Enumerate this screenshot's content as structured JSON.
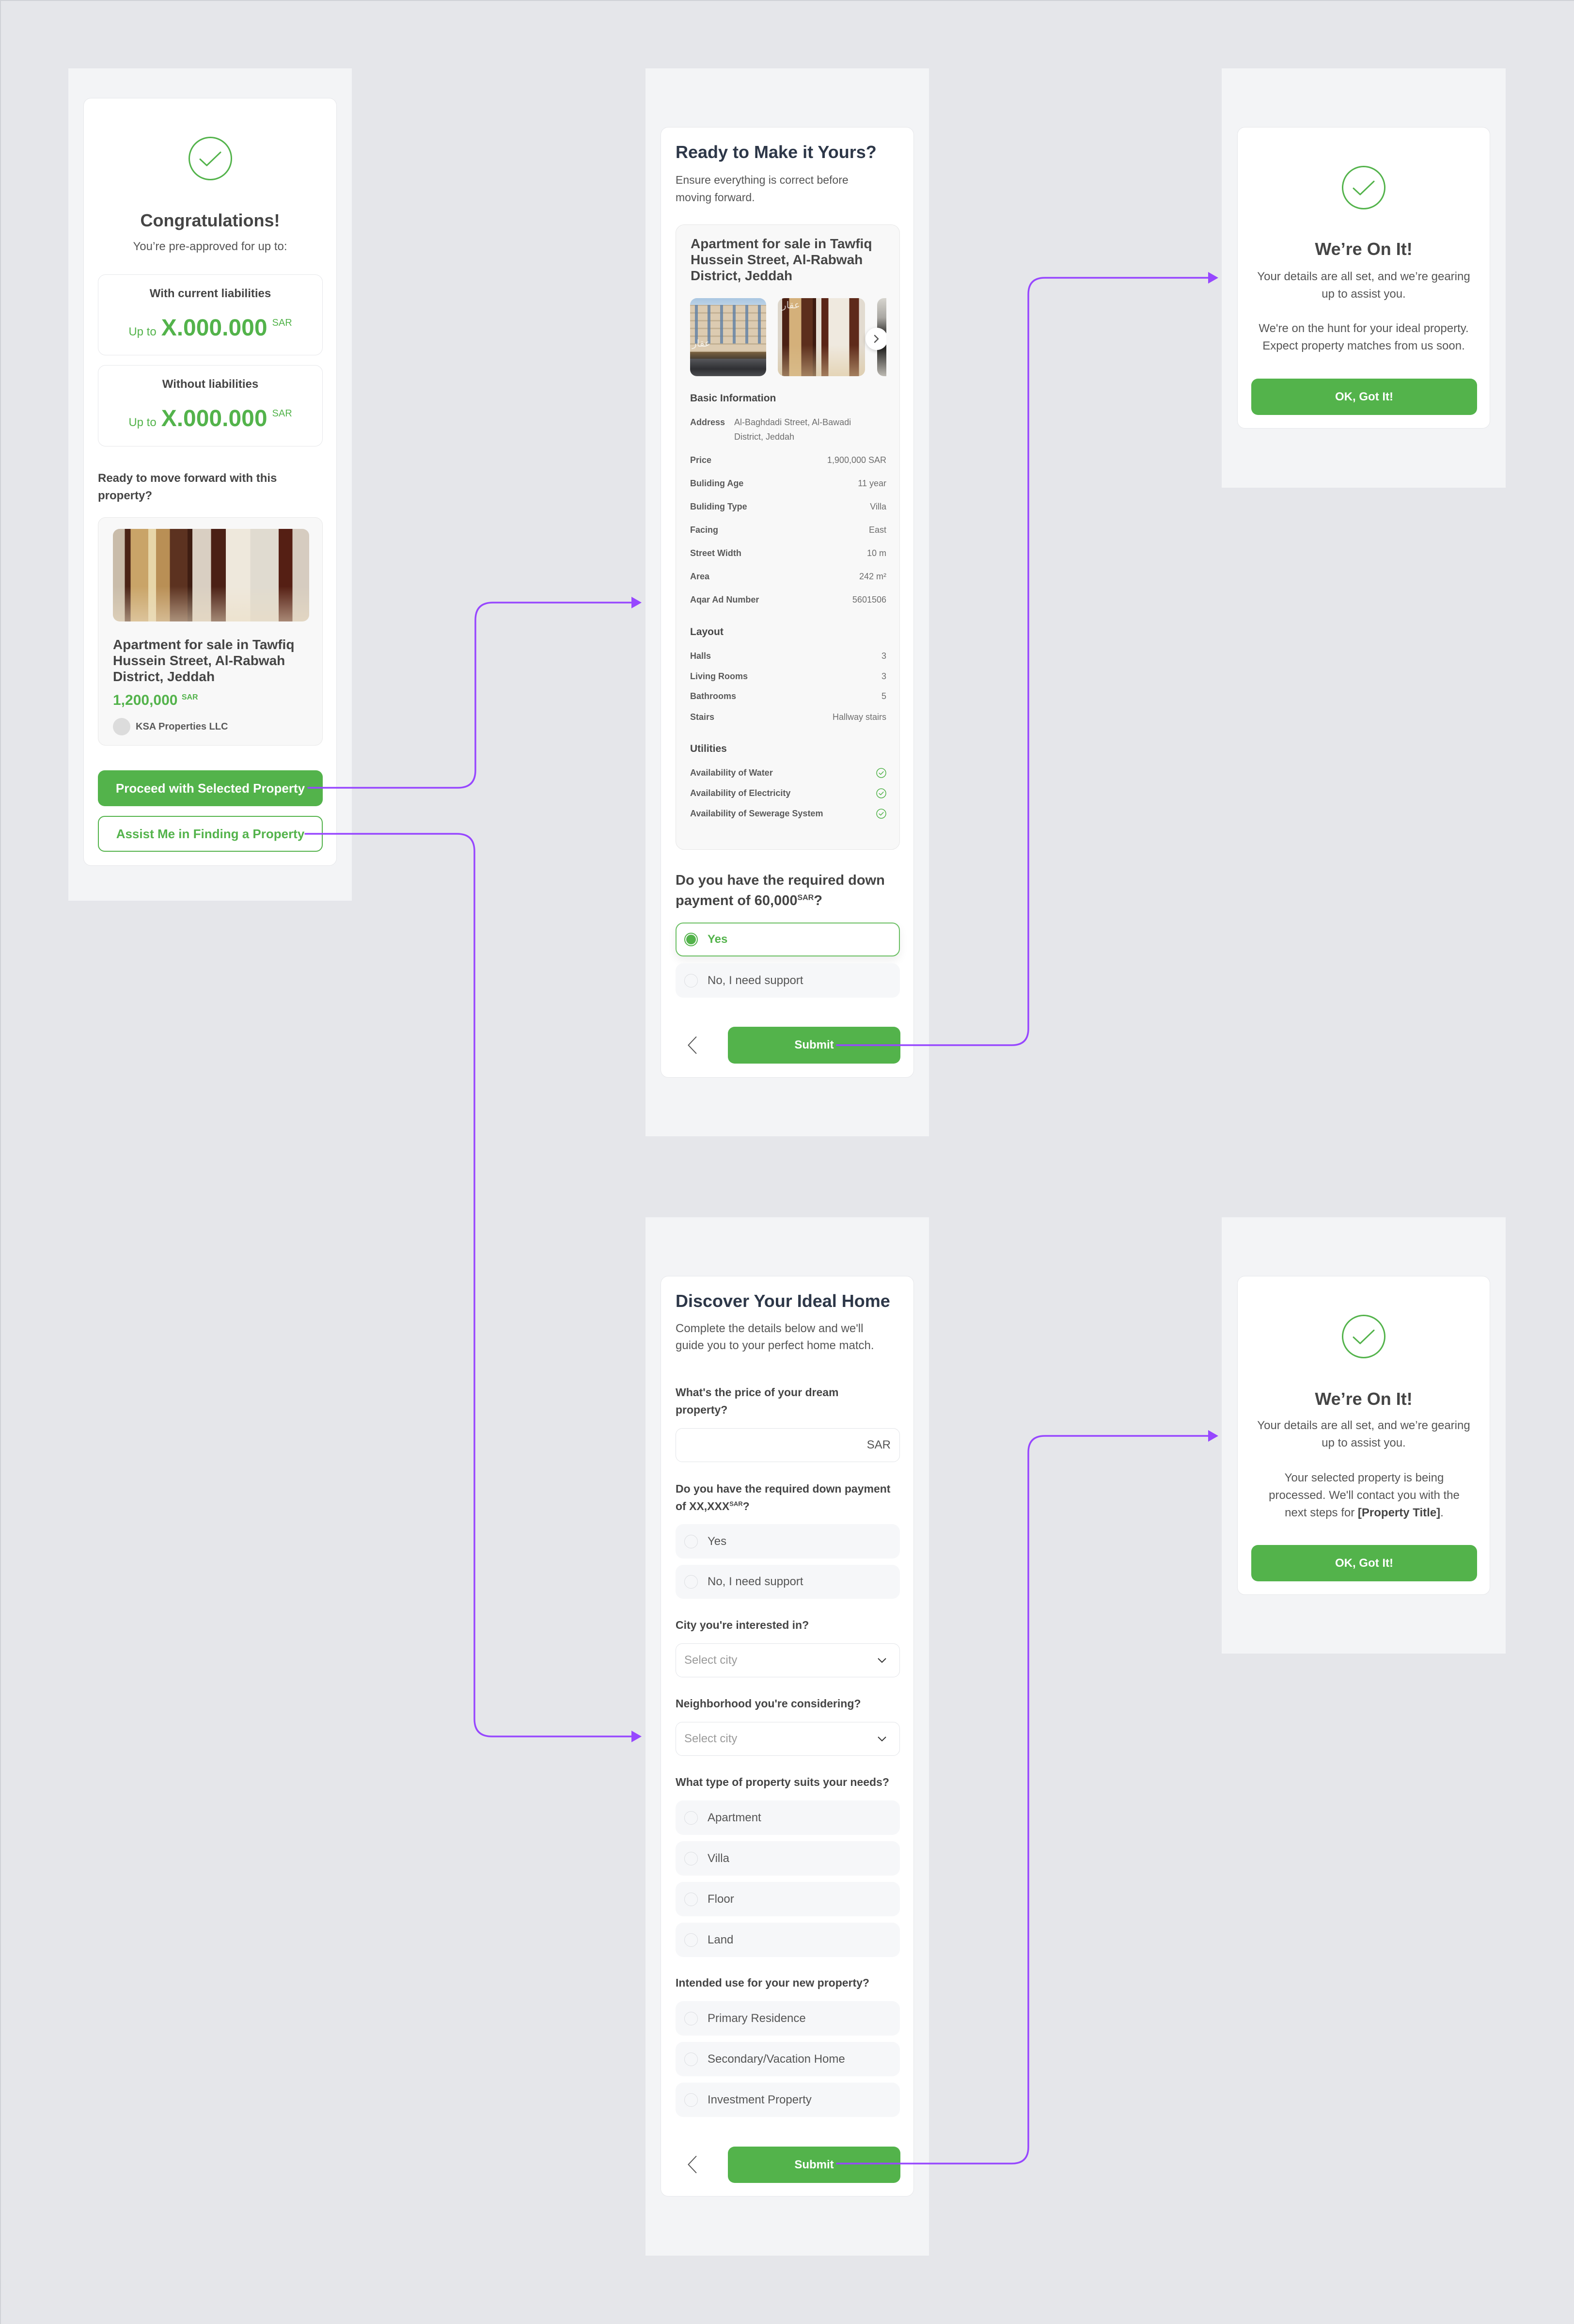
{
  "theme": {
    "accent": "#53b34b",
    "title_navy": "#2d3748",
    "flow_arrow": "#9747ff",
    "canvas": "#e5e6ea"
  },
  "pre_approval": {
    "status_icon": "check-circle-icon",
    "title": "Congratulations!",
    "subtitle": "You’re pre-approved for up to:",
    "offers": [
      {
        "label": "With current liabilities",
        "prefix": "Up to",
        "amount": "X.000.000",
        "currency": "SAR"
      },
      {
        "label": "Without liabilities",
        "prefix": "Up to",
        "amount": "X.000.000",
        "currency": "SAR"
      }
    ],
    "prompt": "Ready to move forward with this property?",
    "property": {
      "photo": "apartment-interior-photo",
      "title": "Apartment for sale in Tawfiq Hussein Street, Al-Rabwah District, Jeddah",
      "price": "1,200,000",
      "currency": "SAR",
      "agent": "KSA Properties LLC",
      "agent_avatar": "avatar-placeholder"
    },
    "primary_button": "Proceed with Selected Property",
    "secondary_button": "Assist Me in Finding a Property"
  },
  "confirm_property": {
    "title": "Ready to Make it Yours?",
    "subtitle": "Ensure everything is correct before moving forward.",
    "property_title": "Apartment for sale in Tawfiq Hussein Street, Al-Rabwah District, Jeddah",
    "gallery": {
      "photos": [
        "building-exterior-photo",
        "apartment-hallway-photo",
        "apartment-room-photo"
      ],
      "watermark": "عقار",
      "next_icon": "chevron-right-icon"
    },
    "basic_info": {
      "heading": "Basic Information",
      "rows": [
        {
          "label": "Address",
          "value": "Al-Baghdadi Street, Al-Bawadi District, Jeddah"
        },
        {
          "label": "Price",
          "value": "1,900,000 SAR"
        },
        {
          "label": "Buliding Age",
          "value": "11 year"
        },
        {
          "label": "Buliding Type",
          "value": "Villa"
        },
        {
          "label": "Facing",
          "value": "East"
        },
        {
          "label": "Street Width",
          "value": "10 m"
        },
        {
          "label": "Area",
          "value": "242 m²"
        },
        {
          "label": "Aqar Ad Number",
          "value": "5601506"
        }
      ]
    },
    "layout": {
      "heading": "Layout",
      "rows": [
        {
          "label": "Halls",
          "value": "3"
        },
        {
          "label": "Living Rooms",
          "value": "3"
        },
        {
          "label": "Bathrooms",
          "value": "5"
        },
        {
          "label": "Stairs",
          "value": "Hallway stairs"
        }
      ]
    },
    "utilities": {
      "heading": "Utilities",
      "icon": "check-circle-icon",
      "rows": [
        {
          "label": "Availability of Water",
          "available": true
        },
        {
          "label": "Availability of Electricity",
          "available": true
        },
        {
          "label": "Availability of Sewerage System",
          "available": true
        }
      ]
    },
    "question": {
      "prefix": "Do you have the required down payment of ",
      "amount": "60,000",
      "currency": "SAR",
      "suffix": "?"
    },
    "options": [
      {
        "label": "Yes",
        "selected": true
      },
      {
        "label": "No, I need support",
        "selected": false
      }
    ],
    "back_icon": "chevron-left-icon",
    "submit": "Submit"
  },
  "search_confirmation": {
    "status_icon": "check-circle-icon",
    "title": "We’re On It!",
    "paragraphs": [
      "Your details are all set, and we’re gearing up to assist you.",
      "We're on the hunt for your ideal property. Expect property matches from us soon."
    ],
    "button": "OK, Got It!"
  },
  "discover_home": {
    "title": "Discover Your Ideal Home",
    "subtitle": "Complete the details below and we'll guide you to your perfect home match.",
    "price_question": "What's the price of your dream property?",
    "price_input": {
      "value": "",
      "suffix": "SAR"
    },
    "down_payment_question": {
      "prefix": "Do you have the required down payment of ",
      "amount": "XX,XXX",
      "currency": "SAR",
      "suffix": "?"
    },
    "down_payment_options": [
      {
        "label": "Yes",
        "selected": false
      },
      {
        "label": "No, I need support",
        "selected": false
      }
    ],
    "city_question": "City you're interested in?",
    "city_select": {
      "placeholder": "Select city",
      "value": ""
    },
    "neighborhood_question": "Neighborhood you're considering?",
    "neighborhood_select": {
      "placeholder": "Select city",
      "value": ""
    },
    "type_question": "What type of property suits your needs?",
    "type_options": [
      {
        "label": "Apartment",
        "selected": false
      },
      {
        "label": "Villa",
        "selected": false
      },
      {
        "label": "Floor",
        "selected": false
      },
      {
        "label": "Land",
        "selected": false
      }
    ],
    "use_question": "Intended use for your new property?",
    "use_options": [
      {
        "label": "Primary Residence",
        "selected": false
      },
      {
        "label": "Secondary/Vacation Home",
        "selected": false
      },
      {
        "label": "Investment Property",
        "selected": false
      }
    ],
    "back_icon": "chevron-left-icon",
    "submit": "Submit"
  },
  "selected_confirmation": {
    "status_icon": "check-circle-icon",
    "title": "We’re On It!",
    "paragraph": "Your details are all set, and we’re gearing up to assist you.",
    "processing": {
      "prefix": "Your selected property is being processed. We'll contact you with the next steps for ",
      "property_placeholder": "[Property Title]",
      "suffix": "."
    },
    "button": "OK, Got It!"
  },
  "flows": [
    {
      "from": "Proceed with Selected Property",
      "to": "Ready to Make it Yours?"
    },
    {
      "from": "Assist Me in Finding a Property",
      "to": "Discover Your Ideal Home"
    },
    {
      "from": "Submit (Ready to Make it Yours?)",
      "to": "We’re On It! (property matches)"
    },
    {
      "from": "Submit (Discover Your Ideal Home)",
      "to": "We’re On It! (selected property)"
    }
  ]
}
